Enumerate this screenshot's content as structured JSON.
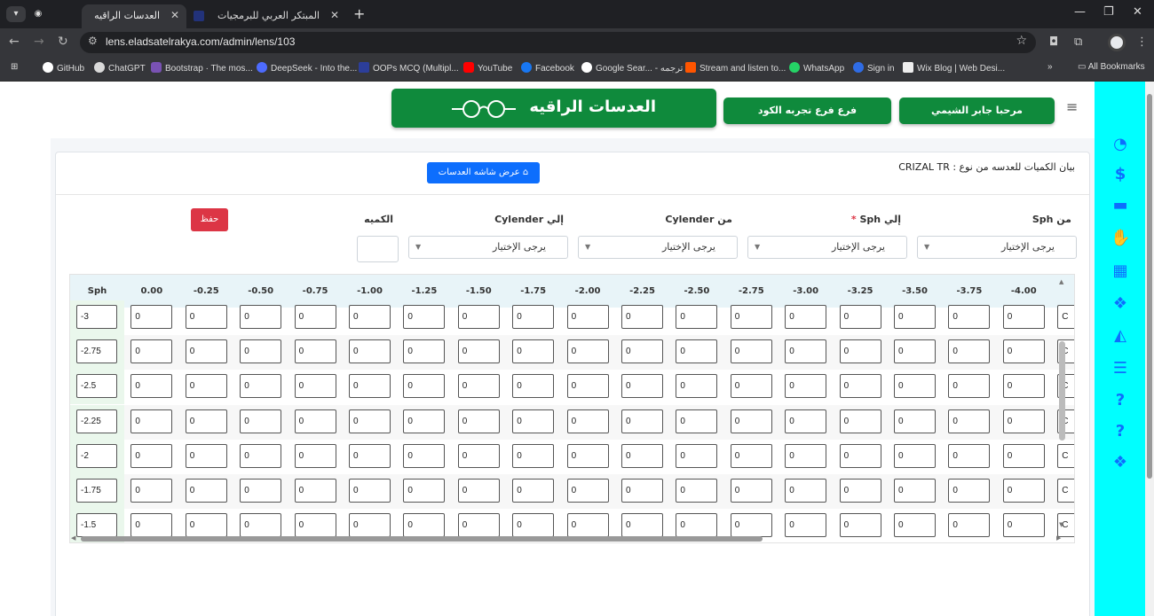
{
  "browser": {
    "tabs": [
      {
        "title": "العدسات الراقيه",
        "active": true
      },
      {
        "title": "المبتكر العربي للبرمجيات",
        "active": false
      }
    ],
    "url": "lens.eladsatelrakya.com/admin/lens/103",
    "bookmarks": [
      {
        "label": "GitHub",
        "color": "#ffffff"
      },
      {
        "label": "ChatGPT",
        "color": "#d9d9d9"
      },
      {
        "label": "Bootstrap · The mos...",
        "color": "#7952b3"
      },
      {
        "label": "DeepSeek - Into the...",
        "color": "#4d6bfe"
      },
      {
        "label": "OOPs MCQ (Multipl...",
        "color": "#2c3e9a"
      },
      {
        "label": "YouTube",
        "color": "#ff0000"
      },
      {
        "label": "Facebook",
        "color": "#1877f2"
      },
      {
        "label": "Google Sear... - ترجمه",
        "color": "#ffffff"
      },
      {
        "label": "Stream and listen to...",
        "color": "#ff5500"
      },
      {
        "label": "WhatsApp",
        "color": "#25d366"
      },
      {
        "label": "Sign in",
        "color": "#2f6ce5"
      },
      {
        "label": "Wix Blog | Web Desi...",
        "color": "#eeeeee"
      }
    ],
    "all_bookmarks": "All Bookmarks"
  },
  "header": {
    "brand": "العدسات الراقيه",
    "branch_button": "فرع فرع تجربه الكود",
    "welcome_button": "مرحبا جابر الشيمي"
  },
  "card": {
    "title": "بيان الكميات للعدسه من نوع : CRIZAL TR",
    "show_lenses_button": "عرض شاشه العدسات",
    "filters": {
      "from_sph": "من Sph",
      "to_sph": "إلي Sph",
      "from_cyl": "من Cylender",
      "to_cyl": "إلي Cylender",
      "qty": "الكميه",
      "select_placeholder": "يرجى الإختيار",
      "save": "حفظ"
    }
  },
  "grid": {
    "sph_header": "Sph",
    "cyl_headers": [
      "0.00",
      "-0.25",
      "-0.50",
      "-0.75",
      "-1.00",
      "-1.25",
      "-1.50",
      "-1.75",
      "-2.00",
      "-2.25",
      "-2.50",
      "-2.75",
      "-3.00",
      "-3.25",
      "-3.50",
      "-3.75",
      "-4.00",
      "-"
    ],
    "rows": [
      {
        "sph": "-3"
      },
      {
        "sph": "-2.75"
      },
      {
        "sph": "-2.5"
      },
      {
        "sph": "-2.25"
      },
      {
        "sph": "-2"
      },
      {
        "sph": "-1.75"
      },
      {
        "sph": "-1.5"
      }
    ],
    "cell_value": "0",
    "last_cell_value": "C"
  },
  "sidebar": {
    "icons": [
      "dashboard-icon",
      "dollar-icon",
      "card-icon",
      "handshake-icon",
      "calculator-icon",
      "cubes-icon",
      "chart-icon",
      "sliders-icon",
      "help-icon",
      "help-icon-2",
      "cubes-icon-2"
    ]
  }
}
